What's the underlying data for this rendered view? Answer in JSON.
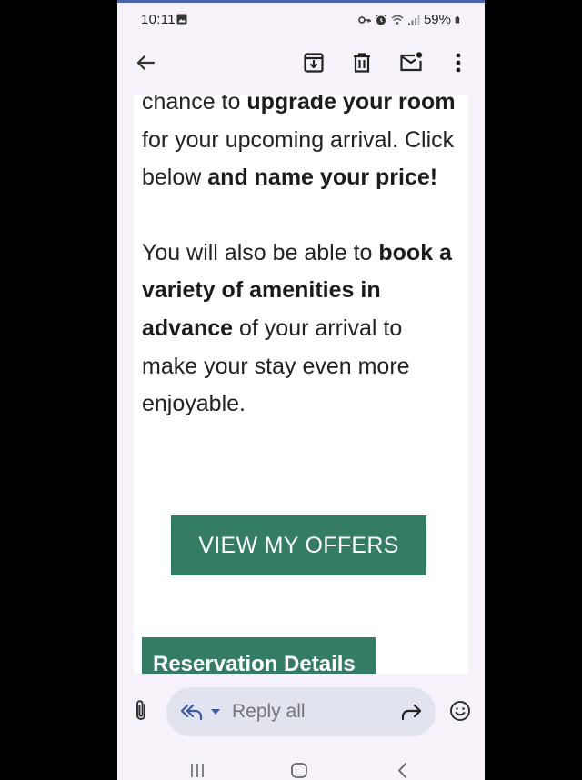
{
  "status_bar": {
    "time": "10:11",
    "battery": "59%",
    "icons": [
      "image-icon",
      "key-icon",
      "alarm-icon",
      "wifi-icon",
      "signal-icon",
      "battery-icon"
    ]
  },
  "app_bar": {
    "icons": [
      "back-arrow-icon",
      "archive-icon",
      "delete-icon",
      "mark-unread-icon",
      "more-vert-icon"
    ]
  },
  "email_body": {
    "p1": {
      "s1": "chance to ",
      "b1": "upgrade your room",
      "s2": " for your upcoming arrival. Click below ",
      "b2": "and name your price!"
    },
    "p2": {
      "s1": "You will also be able to ",
      "b1": "book a variety of amenities in advance",
      "s2": " of your arrival to make your stay even more enjoyable."
    },
    "cta_label": "VIEW MY OFFERS",
    "section_header": "Reservation Details"
  },
  "reply_bar": {
    "placeholder": "Reply all"
  },
  "colors": {
    "brand_green": "#357c64",
    "app_background": "#f7f2fa",
    "reply_pill": "#e1e3ee"
  }
}
